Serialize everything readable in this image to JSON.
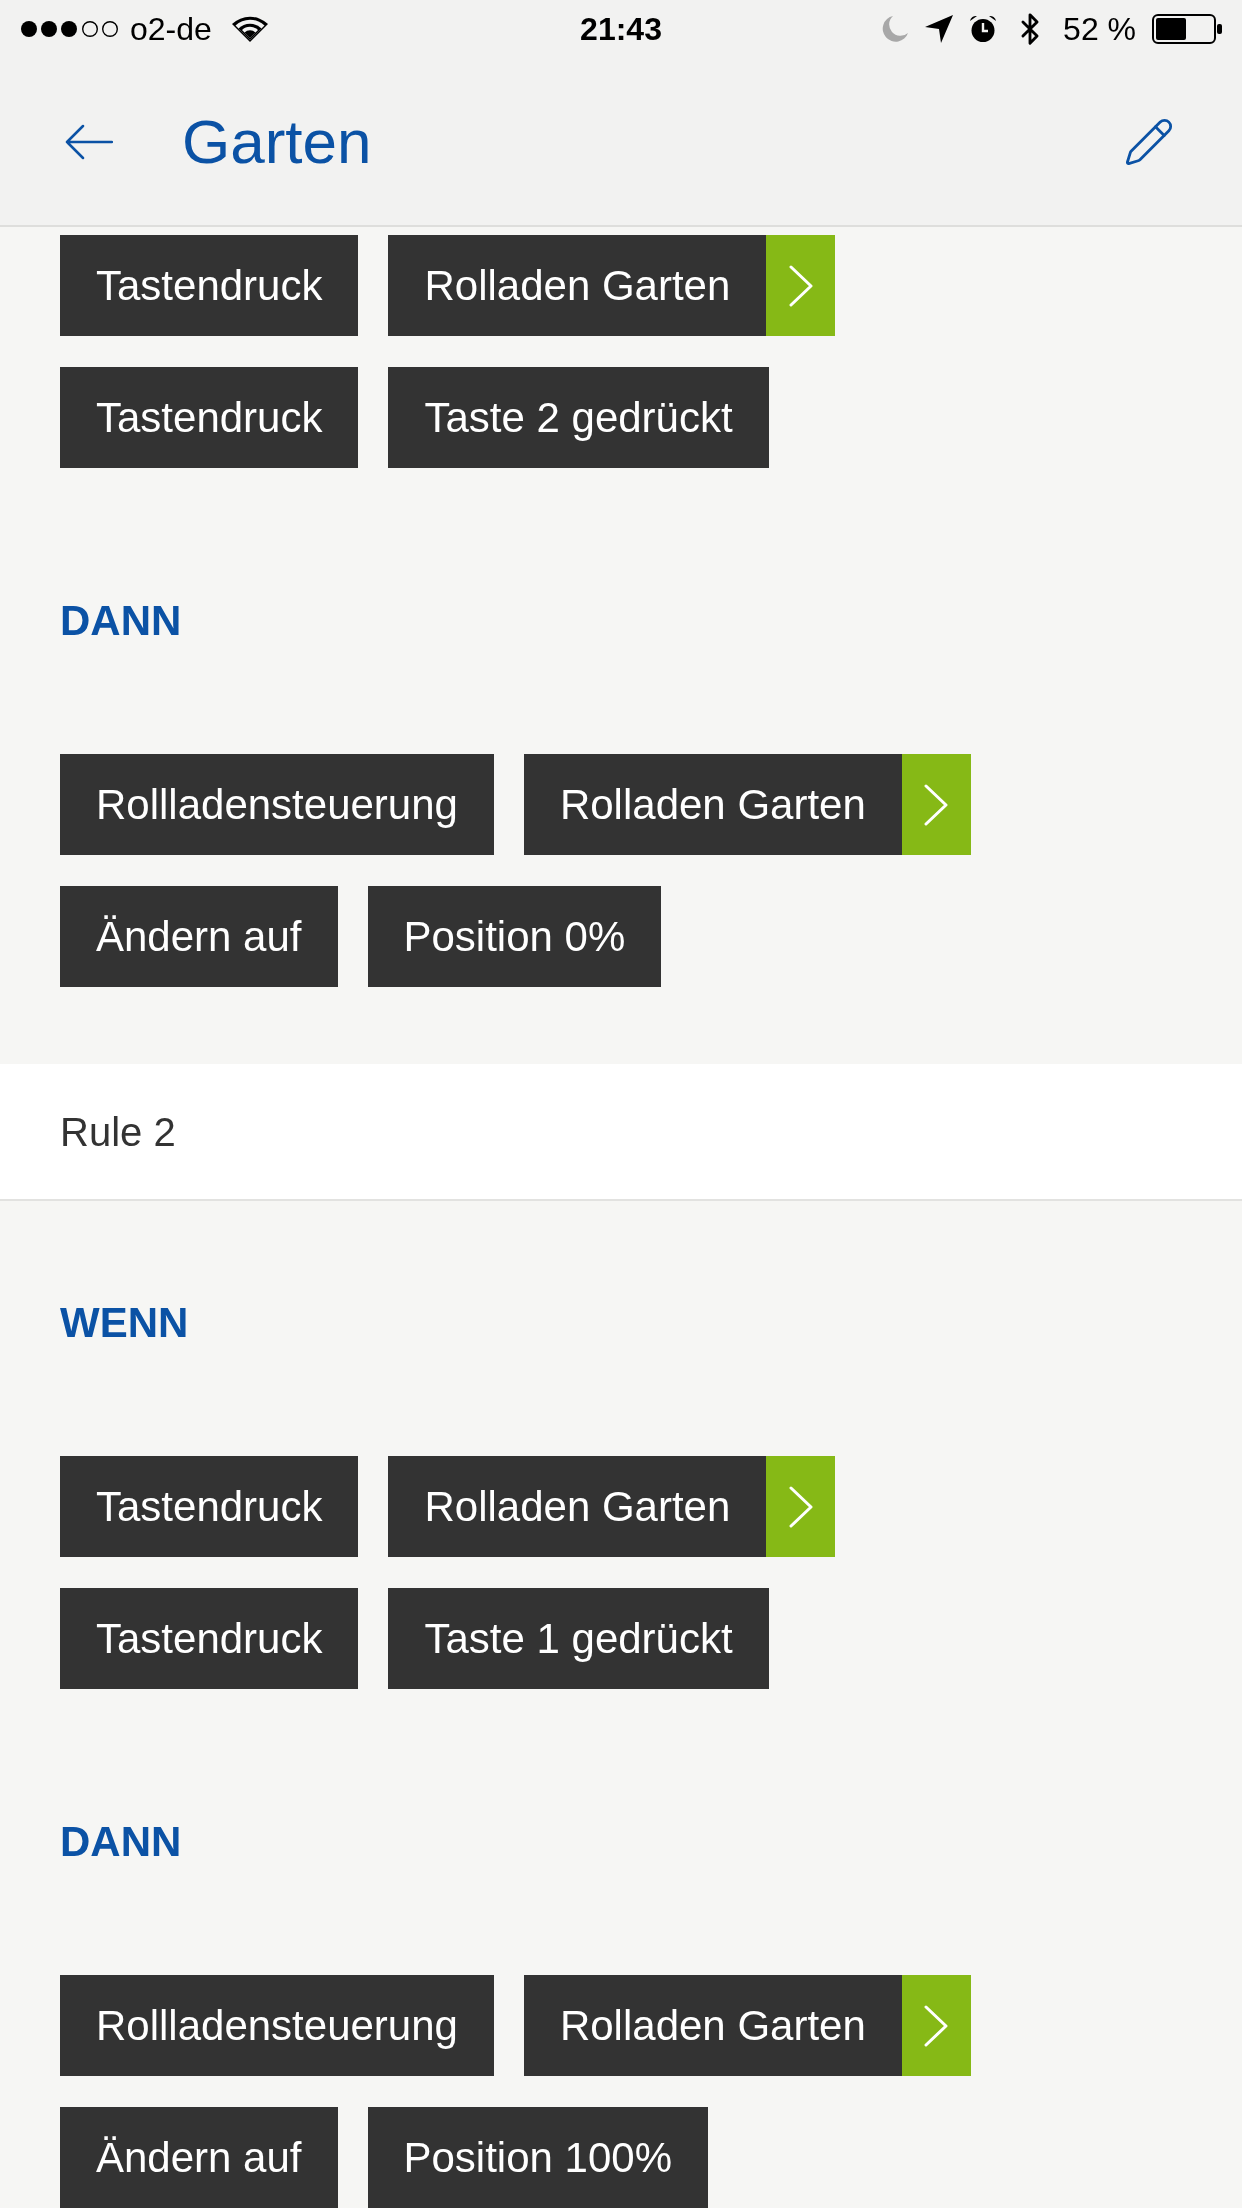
{
  "status_bar": {
    "carrier": "o2-de",
    "time": "21:43",
    "battery": "52 %"
  },
  "header": {
    "title": "Garten"
  },
  "content": [
    {
      "kind": "chip_rows",
      "rows": [
        [
          {
            "kind": "plain",
            "text": "Tastendruck"
          },
          {
            "kind": "device",
            "text": "Rolladen Garten"
          }
        ],
        [
          {
            "kind": "plain",
            "text": "Tastendruck"
          },
          {
            "kind": "plain",
            "text": "Taste 2 gedrückt"
          }
        ]
      ]
    },
    {
      "kind": "heading",
      "text": "DANN"
    },
    {
      "kind": "chip_rows",
      "rows": [
        [
          {
            "kind": "plain",
            "text": "Rollladensteuerung"
          },
          {
            "kind": "device",
            "text": "Rolladen Garten"
          }
        ],
        [
          {
            "kind": "plain",
            "text": "Ändern auf"
          },
          {
            "kind": "plain",
            "text": "Position 0%"
          }
        ]
      ]
    },
    {
      "kind": "rule_title",
      "text": "Rule 2"
    },
    {
      "kind": "heading",
      "text": "WENN"
    },
    {
      "kind": "chip_rows",
      "rows": [
        [
          {
            "kind": "plain",
            "text": "Tastendruck"
          },
          {
            "kind": "device",
            "text": "Rolladen Garten"
          }
        ],
        [
          {
            "kind": "plain",
            "text": "Tastendruck"
          },
          {
            "kind": "plain",
            "text": "Taste 1 gedrückt"
          }
        ]
      ]
    },
    {
      "kind": "heading",
      "text": "DANN"
    },
    {
      "kind": "chip_rows",
      "rows": [
        [
          {
            "kind": "plain",
            "text": "Rollladensteuerung"
          },
          {
            "kind": "device",
            "text": "Rolladen Garten"
          }
        ],
        [
          {
            "kind": "plain",
            "text": "Ändern auf"
          },
          {
            "kind": "plain",
            "text": "Position 100%"
          }
        ]
      ]
    }
  ]
}
